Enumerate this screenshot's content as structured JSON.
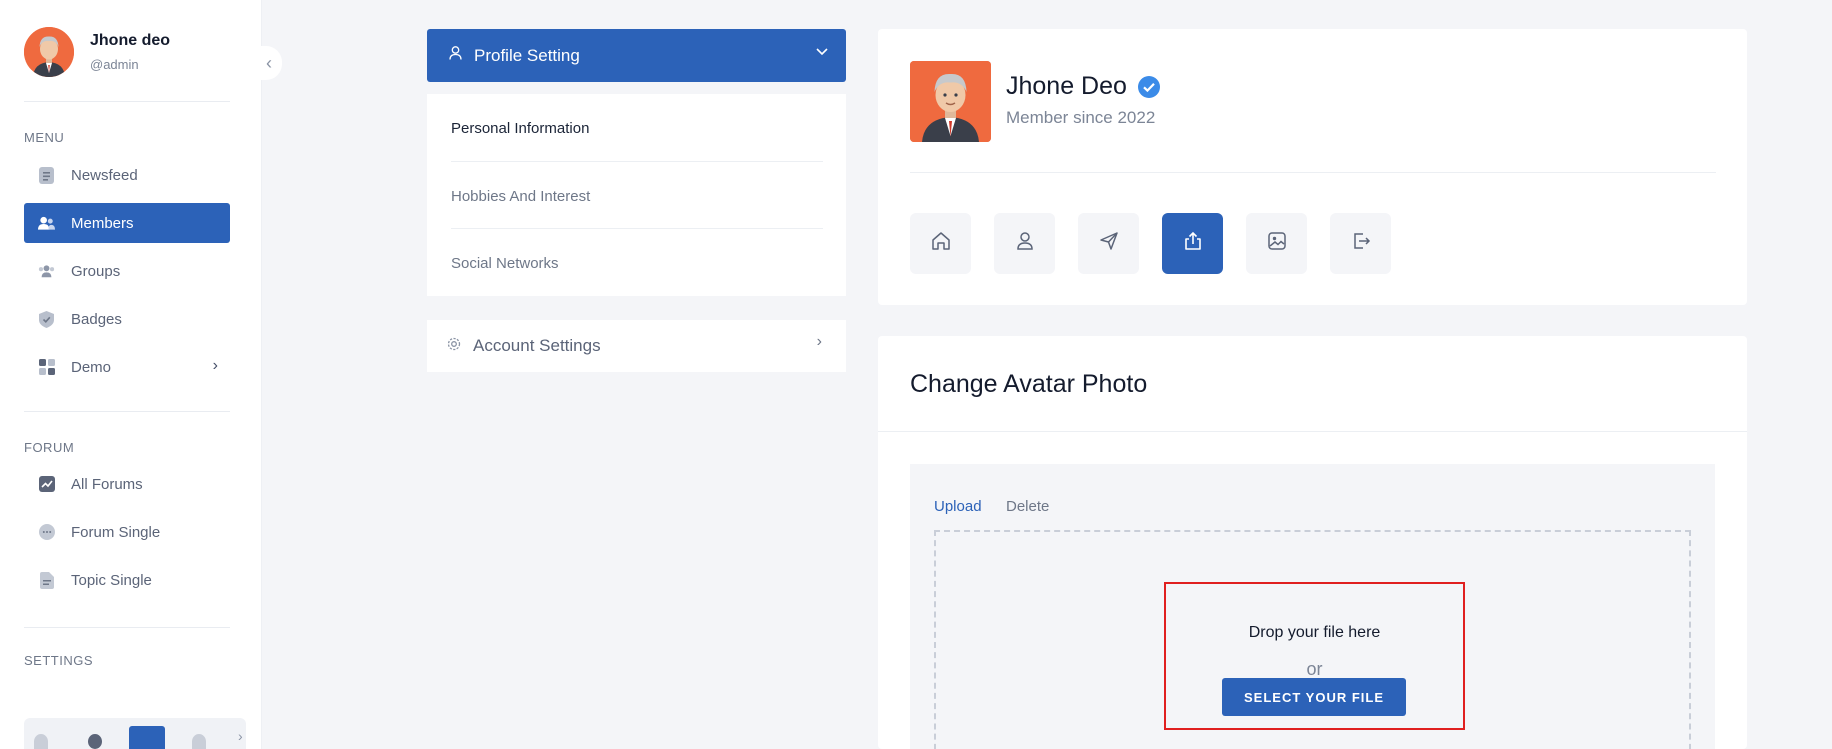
{
  "sidebar": {
    "user": {
      "name": "Jhone deo",
      "handle": "@admin"
    },
    "sections": {
      "menu": "MENU",
      "forum": "FORUM",
      "settings": "SETTINGS"
    },
    "menu_items": [
      {
        "label": "Newsfeed",
        "icon": "newsfeed-icon"
      },
      {
        "label": "Members",
        "icon": "members-icon",
        "active": true
      },
      {
        "label": "Groups",
        "icon": "groups-icon"
      },
      {
        "label": "Badges",
        "icon": "badge-icon"
      },
      {
        "label": "Demo",
        "icon": "grid-icon"
      }
    ],
    "forum_items": [
      {
        "label": "All Forums",
        "icon": "chart-icon"
      },
      {
        "label": "Forum Single",
        "icon": "chat-icon"
      },
      {
        "label": "Topic Single",
        "icon": "document-icon"
      }
    ]
  },
  "profile_menu": {
    "header": "Profile Setting",
    "items": [
      "Personal Information",
      "Hobbies And Interest",
      "Social Networks"
    ],
    "account": "Account Settings"
  },
  "profile_card": {
    "name": "Jhone Deo",
    "since": "Member since 2022",
    "tabs": [
      "home-icon",
      "user-icon",
      "send-icon",
      "upload-icon",
      "image-icon",
      "logout-icon"
    ],
    "active_tab": "upload-icon"
  },
  "avatar_card": {
    "title": "Change Avatar Photo",
    "tabs": [
      "Upload",
      "Delete"
    ],
    "drop_text": "Drop your file here",
    "or_text": "or",
    "select_label": "SELECT YOUR FILE"
  },
  "colors": {
    "primary": "#2c62b8",
    "avatar_bg": "#ef6a3f",
    "verified": "#3b8be8",
    "highlight_border": "#e02020"
  }
}
